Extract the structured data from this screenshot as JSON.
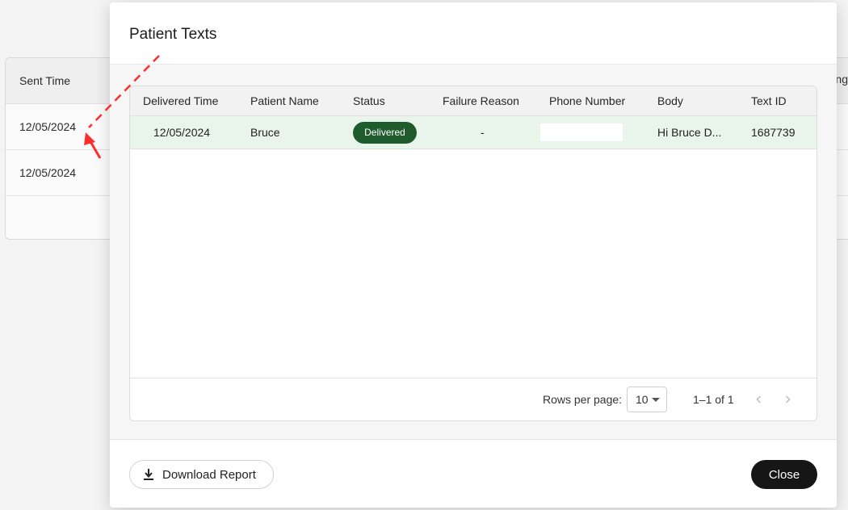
{
  "background": {
    "header": "Sent Time",
    "rows": [
      "12/05/2024",
      "12/05/2024"
    ],
    "right_hint": "ng"
  },
  "modal": {
    "title": "Patient Texts",
    "columns": [
      "Delivered Time",
      "Patient Name",
      "Status",
      "Failure Reason",
      "Phone Number",
      "Body",
      "Text ID"
    ],
    "rows": [
      {
        "delivered_time": "12/05/2024",
        "patient_name": "Bruce",
        "status": "Delivered",
        "failure_reason": "-",
        "phone_number": "",
        "body": "Hi Bruce D...",
        "text_id": "1687739"
      }
    ],
    "pagination": {
      "rows_per_page_label": "Rows per page:",
      "rows_per_page_value": "10",
      "range": "1–1 of 1",
      "prev_icon": "chevron-left-icon",
      "next_icon": "chevron-right-icon"
    },
    "footer": {
      "download_label": "Download Report",
      "download_icon": "download-icon",
      "close_label": "Close"
    }
  },
  "colors": {
    "status_delivered": "#1f5b2d",
    "row_highlight": "#e9f4ea",
    "close_button": "#161616",
    "annotation_arrow": "#ff2d2d"
  }
}
